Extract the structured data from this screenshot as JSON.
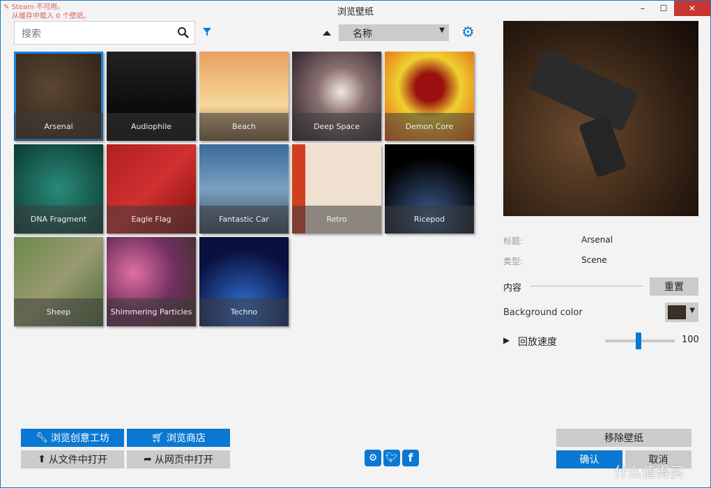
{
  "window": {
    "title": "浏览壁纸",
    "minimize": "–",
    "maximize": "☐",
    "close": "✕"
  },
  "status": {
    "line1": "Steam 不可用。",
    "line2": "从缓存中载入 0 个壁纸。"
  },
  "search": {
    "placeholder": "搜索"
  },
  "sort": {
    "selected": "名称",
    "direction": "ascending"
  },
  "wallpapers": [
    {
      "name": "Arsenal",
      "selected": true
    },
    {
      "name": "Audiophile"
    },
    {
      "name": "Beach"
    },
    {
      "name": "Deep Space"
    },
    {
      "name": "Demon Core"
    },
    {
      "name": "DNA Fragment"
    },
    {
      "name": "Eagle Flag"
    },
    {
      "name": "Fantastic Car"
    },
    {
      "name": "Retro"
    },
    {
      "name": "Ricepod"
    },
    {
      "name": "Sheep"
    },
    {
      "name": "Shimmering Particles"
    },
    {
      "name": "Techno"
    }
  ],
  "details": {
    "title_label": "标题:",
    "title_value": "Arsenal",
    "type_label": "类型:",
    "type_value": "Scene",
    "content_label": "内容",
    "reset": "重置",
    "bg_color_label": "Background color",
    "bg_color": "#3b2f25",
    "speed_label": "回放速度",
    "speed_value": "100"
  },
  "buttons": {
    "workshop": "浏览创意工坊",
    "store": "浏览商店",
    "open_file": "从文件中打开",
    "open_web": "从网页中打开",
    "remove": "移除壁纸",
    "ok": "确认",
    "cancel": "取消"
  },
  "watermark": "什么值得买",
  "colors": {
    "accent": "#0a78d2",
    "close": "#c7372f"
  }
}
